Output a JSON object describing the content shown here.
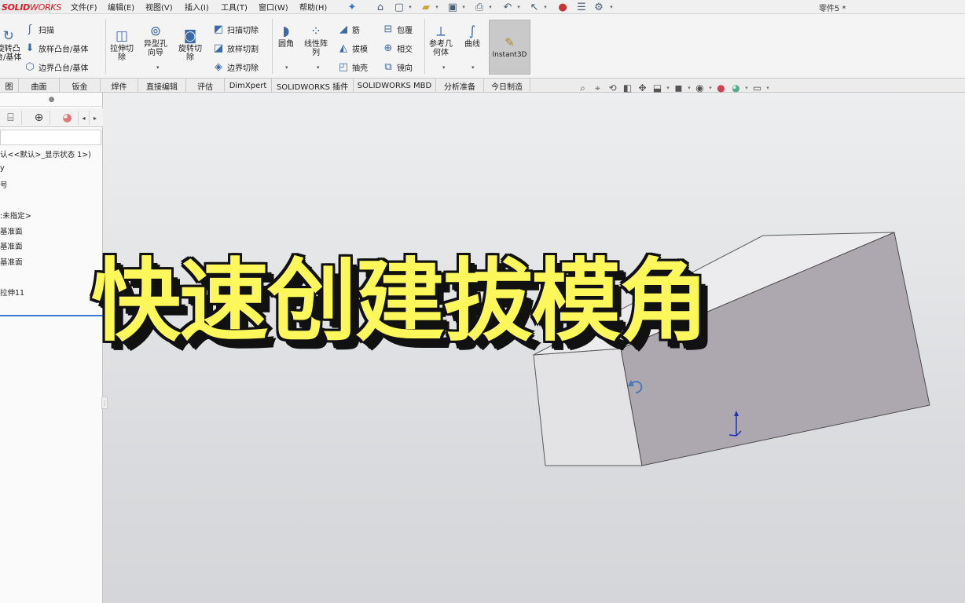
{
  "app": {
    "logo_main": "SOLID",
    "logo_sub": "WORKS",
    "doc_title": "零件5 *"
  },
  "menu": [
    {
      "label": "文件(F)"
    },
    {
      "label": "编辑(E)"
    },
    {
      "label": "视图(V)"
    },
    {
      "label": "插入(I)"
    },
    {
      "label": "工具(T)"
    },
    {
      "label": "窗口(W)"
    },
    {
      "label": "帮助(H)"
    }
  ],
  "commands": {
    "revolve_boss": "旋转凸\n台/基体",
    "sweep": "扫描",
    "loft_boss": "放样凸台/基体",
    "boundary_boss": "边界凸台/基体",
    "extrude_cut": "拉伸切\n除",
    "hole_wizard": "异型孔\n向导",
    "revolve_cut": "旋转切\n除",
    "swept_cut": "扫描切除",
    "lofted_cut": "放样切割",
    "boundary_cut": "边界切除",
    "fillet": "圆角",
    "linear_pattern": "线性阵\n列",
    "rib": "筋",
    "draft": "拔模",
    "shell": "抽壳",
    "wrap": "包覆",
    "intersect": "相交",
    "mirror": "镜向",
    "ref_geometry": "参考几\n何体",
    "curves": "曲线",
    "instant3d": "Instant3D"
  },
  "tabs": [
    {
      "label": "图"
    },
    {
      "label": "曲面"
    },
    {
      "label": "钣金"
    },
    {
      "label": "焊件"
    },
    {
      "label": "直接编辑"
    },
    {
      "label": "评估"
    },
    {
      "label": "DimXpert"
    },
    {
      "label": "SOLIDWORKS 插件"
    },
    {
      "label": "SOLIDWORKS MBD"
    },
    {
      "label": "分析准备"
    },
    {
      "label": "今日制造"
    }
  ],
  "tree": {
    "config": "认<<默认>_显示状态 1>)",
    "history": "y",
    "sensors": "号",
    "material": ":未指定>",
    "front_plane": "基准面",
    "top_plane": "基准面",
    "right_plane": "基准面",
    "extrude": "拉伸11"
  },
  "overlay_title": "快速创建拔模角",
  "colors": {
    "title_fill": "#fcf85c",
    "title_outline": "#111111",
    "part_face": "#ada7b0",
    "part_side": "#e4e4e6"
  }
}
